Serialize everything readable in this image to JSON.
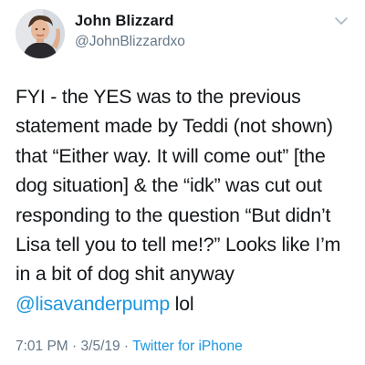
{
  "author": {
    "name": "John Blizzard",
    "handle": "@JohnBlizzardxo"
  },
  "tweet": {
    "lines": [
      "FYI - the YES was to the previous",
      "statement made by Teddi (not shown)",
      "that “Either way. It will come out” [the",
      "dog situation] & the “idk” was cut out",
      "responding to the question “But didn’t",
      "Lisa tell you to tell me!?” Looks like I’m",
      "in a bit of dog shit anyway"
    ],
    "mention": "@lisavanderpump",
    "trailing_text": " lol"
  },
  "meta": {
    "time": "7:01 PM",
    "date": "3/5/19",
    "separator": " · ",
    "source": "Twitter for iPhone"
  },
  "icons": {
    "menu": "chevron-down-icon",
    "avatar": "profile-photo"
  },
  "colors": {
    "text": "#14171a",
    "secondary": "#657786",
    "link": "#1b95e0",
    "background": "#ffffff"
  }
}
